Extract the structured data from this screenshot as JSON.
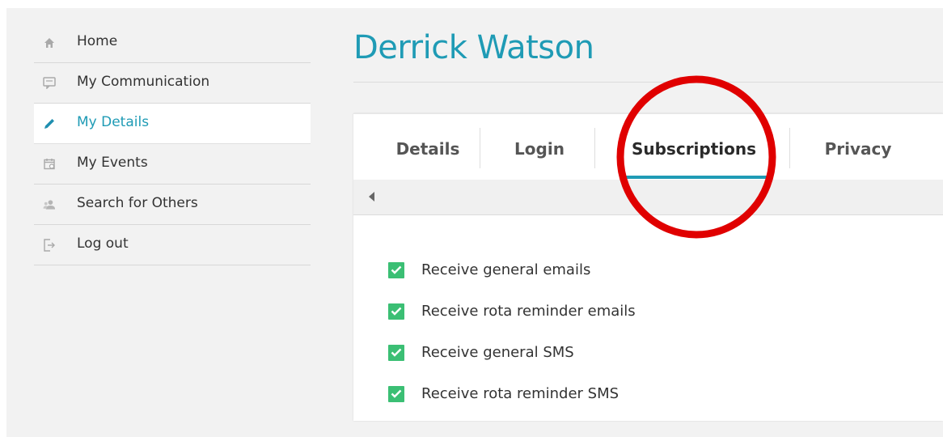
{
  "sidebar": {
    "items": [
      {
        "label": "Home",
        "icon": "home-icon"
      },
      {
        "label": "My Communication",
        "icon": "chat-icon"
      },
      {
        "label": "My Details",
        "icon": "pencil-icon",
        "active": true
      },
      {
        "label": "My Events",
        "icon": "calendar-icon"
      },
      {
        "label": "Search for Others",
        "icon": "users-icon"
      },
      {
        "label": "Log out",
        "icon": "logout-icon"
      }
    ]
  },
  "page": {
    "title": "Derrick Watson"
  },
  "tabs": {
    "items": [
      {
        "label": "Details"
      },
      {
        "label": "Login"
      },
      {
        "label": "Subscriptions",
        "active": true
      },
      {
        "label": "Privacy"
      }
    ]
  },
  "subscriptions": {
    "items": [
      {
        "label": "Receive general emails",
        "checked": true
      },
      {
        "label": "Receive rota reminder emails",
        "checked": true
      },
      {
        "label": "Receive general SMS",
        "checked": true
      },
      {
        "label": "Receive rota reminder SMS",
        "checked": true
      }
    ]
  },
  "colors": {
    "accent": "#1f9bb5",
    "checkbox": "#3bbf74",
    "annotation": "#e00000"
  }
}
